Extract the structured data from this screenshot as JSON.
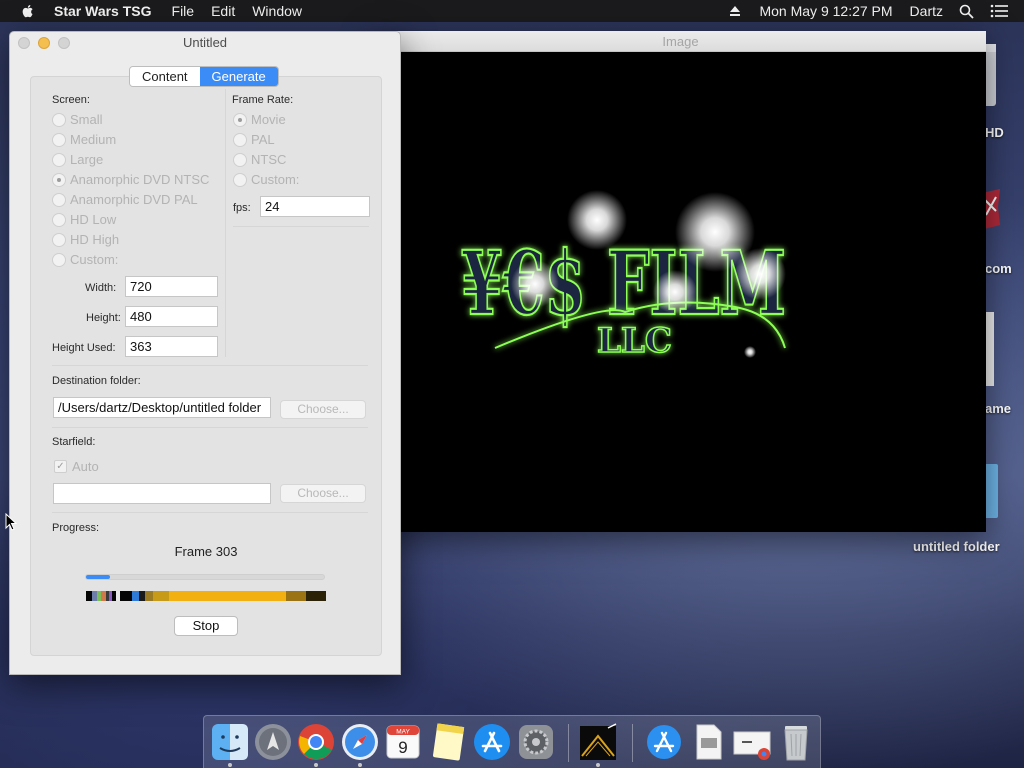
{
  "menubar": {
    "app_name": "Star Wars TSG",
    "menus": [
      "File",
      "Edit",
      "Window"
    ],
    "clock": "Mon May 9  12:27 PM",
    "user": "Dartz"
  },
  "desktop": {
    "items": [
      {
        "label": "HD"
      },
      {
        "label": "com"
      },
      {
        "label": "ame"
      },
      {
        "label": "untitled folder"
      }
    ]
  },
  "image_window": {
    "title": "Image",
    "logo_main": "¥€$ FILM",
    "logo_sub": "LLC"
  },
  "main_window": {
    "title": "Untitled",
    "tabs": [
      {
        "label": "Content",
        "active": false
      },
      {
        "label": "Generate",
        "active": true
      }
    ],
    "screen": {
      "label": "Screen:",
      "options": [
        "Small",
        "Medium",
        "Large",
        "Anamorphic DVD NTSC",
        "Anamorphic DVD PAL",
        "HD Low",
        "HD High",
        "Custom:"
      ],
      "selected": "Anamorphic DVD NTSC",
      "width_label": "Width:",
      "width_value": "720",
      "height_label": "Height:",
      "height_value": "480",
      "height_used_label": "Height Used:",
      "height_used_value": "363"
    },
    "frame_rate": {
      "label": "Frame Rate:",
      "options": [
        "Movie",
        "PAL",
        "NTSC",
        "Custom:"
      ],
      "selected": "Movie",
      "fps_label": "fps:",
      "fps_value": "24"
    },
    "destination": {
      "label": "Destination folder:",
      "path": "/Users/dartz/Desktop/untitled folder",
      "choose_label": "Choose..."
    },
    "starfield": {
      "label": "Starfield:",
      "auto_label": "Auto",
      "auto_checked": true,
      "path": "",
      "choose_label": "Choose..."
    },
    "progress": {
      "label": "Progress:",
      "status": "Frame 303",
      "fraction": 0.1,
      "stop_label": "Stop"
    }
  },
  "dock": {
    "apps": [
      "finder-icon",
      "launchpad-icon",
      "chrome-icon",
      "safari-icon",
      "calendar-icon",
      "notes-icon",
      "app-store-icon",
      "system-preferences-icon",
      "star-wars-tsg-icon",
      "app-store-downloads-icon",
      "document-icon",
      "chrome-app-icon",
      "trash-icon"
    ],
    "calendar_month": "MAY",
    "calendar_day": "9"
  },
  "colors": {
    "accent": "#3b8cf7",
    "menubar": "#1b1b1d",
    "logo_glow": "#7dff4a"
  }
}
